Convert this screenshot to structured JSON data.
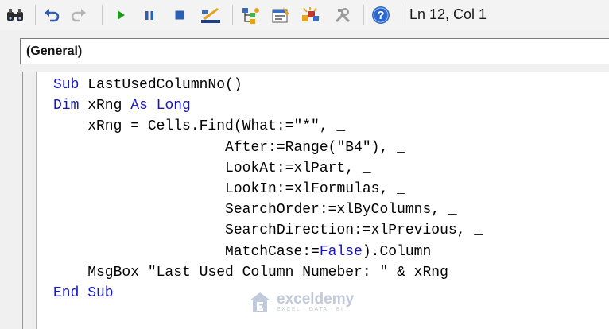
{
  "toolbar": {
    "status": "Ln 12, Col 1",
    "buttons": [
      "find-icon",
      "undo-icon",
      "redo-icon",
      "run-icon",
      "pause-icon",
      "stop-icon",
      "design-mode-icon",
      "project-explorer-icon",
      "properties-icon",
      "object-browser-icon",
      "toolbox-icon",
      "help-icon"
    ]
  },
  "object_dropdown": {
    "value": "(General)"
  },
  "code": {
    "lines": [
      [
        {
          "t": "Sub",
          "k": true
        },
        {
          "t": " LastUsedColumnNo()"
        }
      ],
      [
        {
          "t": "Dim",
          "k": true
        },
        {
          "t": " xRng "
        },
        {
          "t": "As",
          "k": true
        },
        {
          "t": " "
        },
        {
          "t": "Long",
          "k": true
        }
      ],
      [
        {
          "t": "    xRng = Cells.Find(What:=\"*\", _"
        }
      ],
      [
        {
          "t": "                    After:=Range(\"B4\"), _"
        }
      ],
      [
        {
          "t": "                    LookAt:=xlPart, _"
        }
      ],
      [
        {
          "t": "                    LookIn:=xlFormulas, _"
        }
      ],
      [
        {
          "t": "                    SearchOrder:=xlByColumns, _"
        }
      ],
      [
        {
          "t": "                    SearchDirection:=xlPrevious, _"
        }
      ],
      [
        {
          "t": "                    MatchCase:="
        },
        {
          "t": "False",
          "k": true
        },
        {
          "t": ").Column"
        }
      ],
      [
        {
          "t": "    MsgBox \"Last Used Column Numeber: \" & xRng"
        }
      ],
      [
        {
          "t": "End Sub",
          "k": true
        }
      ]
    ]
  },
  "watermark": {
    "brand": "exceldemy",
    "tagline": "EXCEL · DATA · BI"
  },
  "colors": {
    "keyword": "#1414c8",
    "toolbar_bg": "#f3f3f3",
    "run": "#1f9a1f",
    "pause_stop": "#2b5fb3",
    "help": "#2c67c9"
  }
}
